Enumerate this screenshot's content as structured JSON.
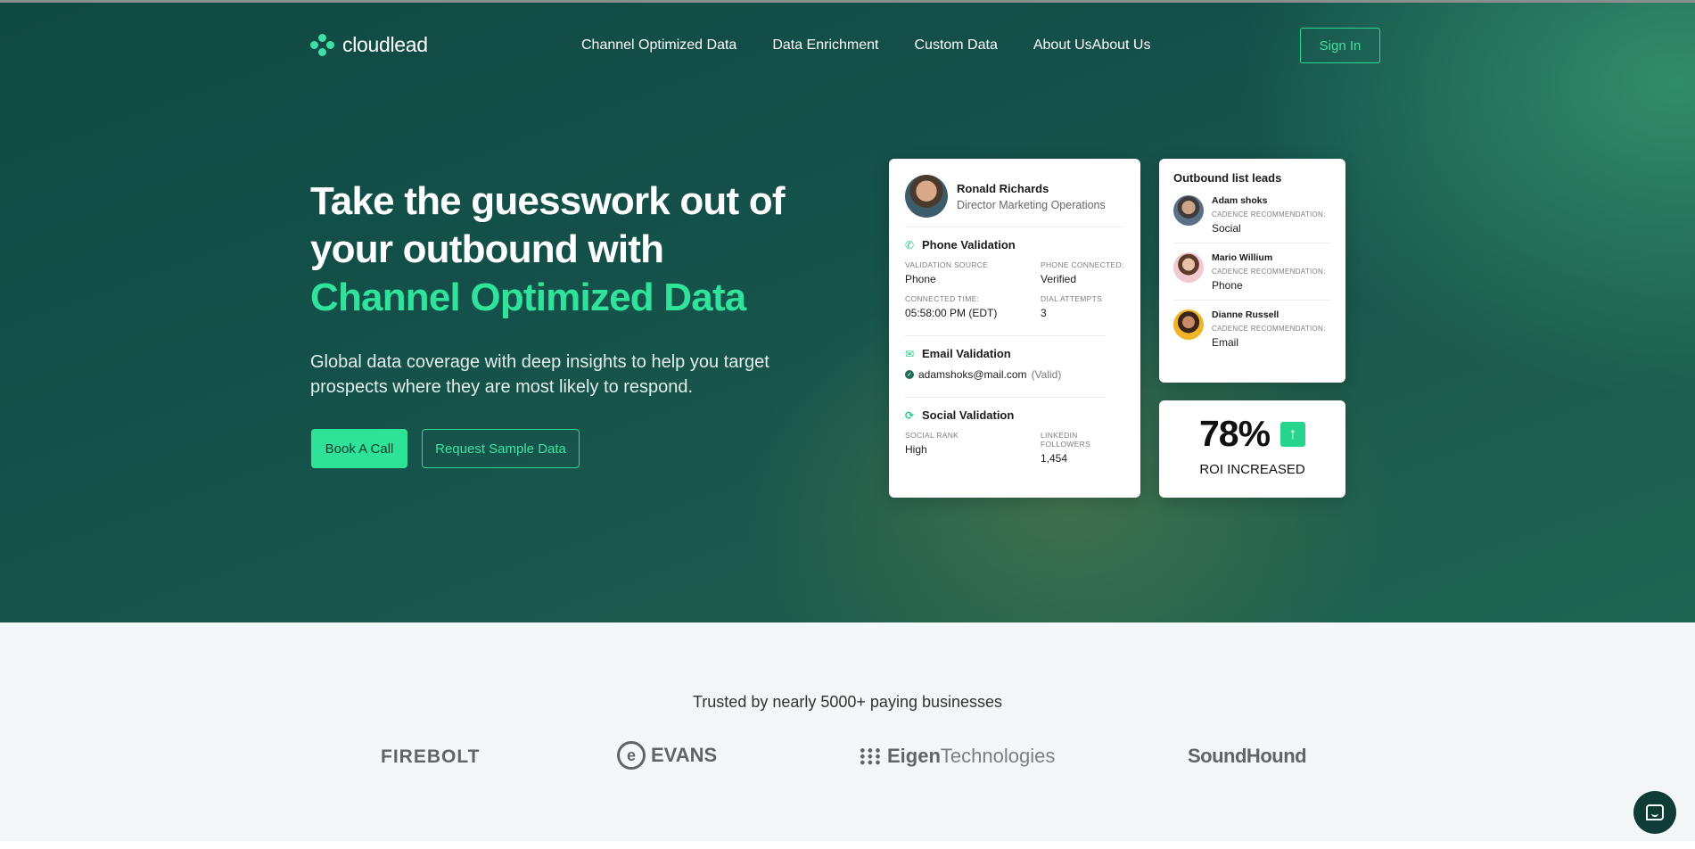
{
  "brand": {
    "name": "cloudlead"
  },
  "nav": {
    "items": [
      "Channel Optimized Data",
      "Data Enrichment",
      "Custom Data",
      "About UsAbout Us"
    ],
    "sign_in": "Sign In"
  },
  "hero": {
    "headline_line1": "Take the guesswork out of",
    "headline_line2": "your outbound with",
    "headline_accent": "Channel Optimized Data",
    "subtext": "Global data coverage with deep insights to help you target prospects where they are most likely to respond.",
    "primary_cta": "Book A Call",
    "secondary_cta": "Request Sample Data"
  },
  "profile_card": {
    "name": "Ronald Richards",
    "role": "Director Marketing Operations",
    "phone": {
      "title": "Phone Validation",
      "fields": [
        {
          "label": "VALIDATION SOURCE",
          "value": "Phone"
        },
        {
          "label": "PHONE CONNECTED:",
          "value": "Verified"
        },
        {
          "label": "CONNECTED TIME:",
          "value": "05:58:00 PM (EDT)"
        },
        {
          "label": "DIAL ATTEMPTS",
          "value": "3"
        }
      ]
    },
    "email": {
      "title": "Email Validation",
      "address": "adamshoks@mail.com",
      "status": "(Valid)"
    },
    "social": {
      "title": "Social Validation",
      "fields": [
        {
          "label": "SOCIAL RANK",
          "value": "High"
        },
        {
          "label": "LINKEDIN FOLLOWERS",
          "value": "1,454"
        }
      ]
    }
  },
  "leads_card": {
    "title": "Outbound list leads",
    "leads": [
      {
        "name": "Adam shoks",
        "label": "CADENCE RECOMMENDATION:",
        "value": "Social",
        "avatar_color": "#5b6f86"
      },
      {
        "name": "Mario Willium",
        "label": "CADENCE RECOMMENDATION:",
        "value": "Phone",
        "avatar_color": "#f1c9cf"
      },
      {
        "name": "Dianne Russell",
        "label": "CADENCE RECOMMENDATION:",
        "value": "Email",
        "avatar_color": "#f0b429"
      }
    ]
  },
  "roi_card": {
    "value": "78%",
    "label": "ROI INCREASED"
  },
  "trusted": {
    "text": "Trusted by nearly 5000+ paying businesses",
    "logos": {
      "firebolt": "FIREBOLT",
      "evans": "EVANS",
      "eigen_bold": "Eigen",
      "eigen_light": "Technologies",
      "soundhound": "SoundHound"
    }
  },
  "colors": {
    "accent": "#2ee397",
    "hero_dark": "#0f4a42",
    "hero_light": "#369670"
  }
}
